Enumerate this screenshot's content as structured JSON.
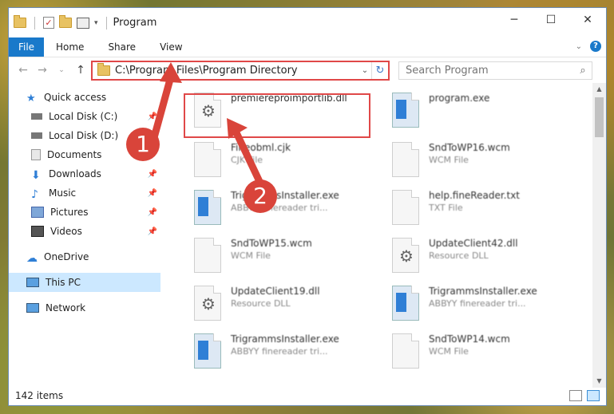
{
  "window": {
    "title": "Program"
  },
  "ribbon": {
    "tabs": [
      "File",
      "Home",
      "Share",
      "View"
    ],
    "help": "?"
  },
  "address": {
    "path": "C:\\Program Files\\Program Directory"
  },
  "search": {
    "placeholder": "Search Program"
  },
  "sidebar": {
    "items": [
      {
        "label": "Quick access",
        "icon": "star-icon"
      },
      {
        "label": "Local Disk (C:)",
        "icon": "drive-icon"
      },
      {
        "label": "Local Disk (D:)",
        "icon": "drive-icon"
      },
      {
        "label": "Documents",
        "icon": "documents-icon"
      },
      {
        "label": "Downloads",
        "icon": "download-icon"
      },
      {
        "label": "Music",
        "icon": "music-icon"
      },
      {
        "label": "Pictures",
        "icon": "pictures-icon"
      },
      {
        "label": "Videos",
        "icon": "videos-icon"
      },
      {
        "label": "OneDrive",
        "icon": "cloud-icon"
      },
      {
        "label": "This PC",
        "icon": "computer-icon"
      },
      {
        "label": "Network",
        "icon": "network-icon"
      }
    ]
  },
  "files": [
    {
      "name": "premiereproimportlib.dll",
      "type": ""
    },
    {
      "name": "program.exe",
      "type": ""
    },
    {
      "name": "Fineobml.cjk",
      "type": "CJK File"
    },
    {
      "name": "SndToWP16.wcm",
      "type": "WCM File"
    },
    {
      "name": "TrigrammsInstaller.exe",
      "type": "ABBYY finereader tri..."
    },
    {
      "name": "help.fineReader.txt",
      "type": "TXT File"
    },
    {
      "name": "SndToWP15.wcm",
      "type": "WCM File"
    },
    {
      "name": "UpdateClient42.dll",
      "type": "Resource DLL"
    },
    {
      "name": "UpdateClient19.dll",
      "type": "Resource DLL"
    },
    {
      "name": "TrigrammsInstaller.exe",
      "type": "ABBYY finereader tri..."
    },
    {
      "name": "TrigrammsInstaller.exe",
      "type": "ABBYY finereader tri..."
    },
    {
      "name": "SndToWP14.wcm",
      "type": "WCM File"
    }
  ],
  "status": {
    "count": "142 items"
  },
  "annotations": {
    "step1": "1",
    "step2": "2"
  },
  "colors": {
    "accent": "#1979ca",
    "highlight": "#e04848",
    "selected": "#cce8ff"
  }
}
